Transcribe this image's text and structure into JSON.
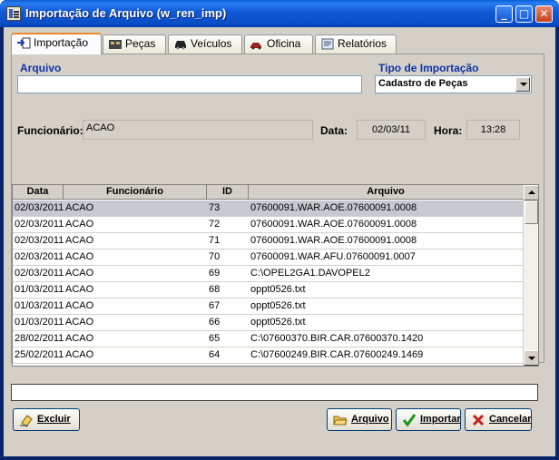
{
  "window": {
    "title": "Importação de Arquivo (w_ren_imp)"
  },
  "tabs": [
    {
      "label": "Importação",
      "icon": "import-icon",
      "active": true
    },
    {
      "label": "Peças",
      "icon": "parts-icon"
    },
    {
      "label": "Veículos",
      "icon": "car-icon"
    },
    {
      "label": "Oficina",
      "icon": "workshop-icon"
    },
    {
      "label": "Relatórios",
      "icon": "report-icon"
    }
  ],
  "form": {
    "arquivo_label": "Arquivo",
    "arquivo_value": "",
    "tipo_label": "Tipo de Importação",
    "tipo_value": "Cadastro de Peças",
    "funcionario_label": "Funcionário:",
    "funcionario_value": "ACAO",
    "data_label": "Data:",
    "data_value": "02/03/11",
    "hora_label": "Hora:",
    "hora_value": "13:28"
  },
  "table": {
    "columns": [
      "Data",
      "Funcionário",
      "ID",
      "Arquivo"
    ],
    "rows": [
      [
        "02/03/2011",
        "ACAO",
        "73",
        "07600091.WAR.AOE.07600091.0008"
      ],
      [
        "02/03/2011",
        "ACAO",
        "72",
        "07600091.WAR.AOE.07600091.0008"
      ],
      [
        "02/03/2011",
        "ACAO",
        "71",
        "07600091.WAR.AOE.07600091.0008"
      ],
      [
        "02/03/2011",
        "ACAO",
        "70",
        "07600091.WAR.AFU.07600091.0007"
      ],
      [
        "02/03/2011",
        "ACAO",
        "69",
        "C:\\OPEL2GA1.DAVOPEL2"
      ],
      [
        "01/03/2011",
        "ACAO",
        "68",
        "oppt0526.txt"
      ],
      [
        "01/03/2011",
        "ACAO",
        "67",
        "oppt0526.txt"
      ],
      [
        "01/03/2011",
        "ACAO",
        "66",
        "oppt0526.txt"
      ],
      [
        "28/02/2011",
        "ACAO",
        "65",
        "C:\\07600370.BIR.CAR.07600370.1420"
      ],
      [
        "25/02/2011",
        "ACAO",
        "64",
        "C:\\07600249.BIR.CAR.07600249.1469"
      ]
    ],
    "selected_row": 0
  },
  "status_text": "",
  "buttons": {
    "excluir": "Excluir",
    "arquivo": "Arquivo",
    "importar": "Importar",
    "cancelar": "Cancelar"
  }
}
